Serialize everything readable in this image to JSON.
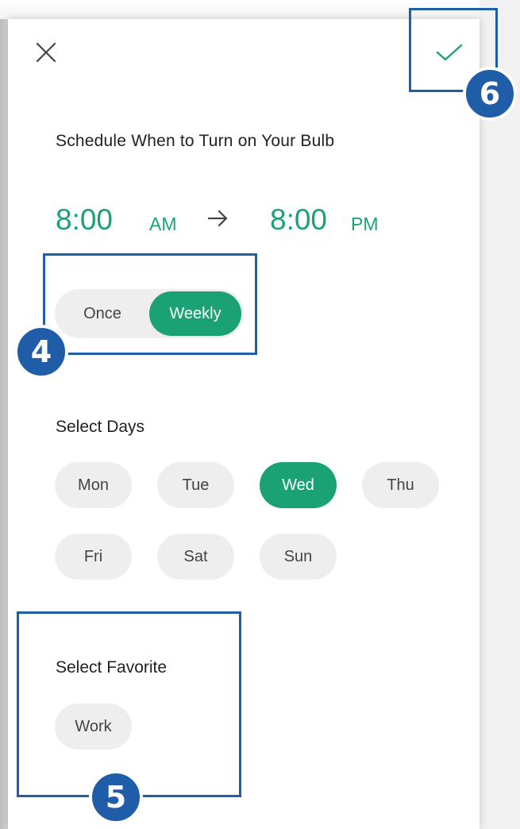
{
  "header": {
    "close_icon": "close-icon",
    "confirm_icon": "check-icon"
  },
  "title": "Schedule When to Turn on Your Bulb",
  "time_range": {
    "start_time": "8:00",
    "start_period": "AM",
    "end_time": "8:00",
    "end_period": "PM",
    "arrow_icon": "arrow-right-icon"
  },
  "frequency": {
    "options": [
      "Once",
      "Weekly"
    ],
    "selected": "Weekly"
  },
  "days": {
    "label": "Select Days",
    "items": [
      "Mon",
      "Tue",
      "Wed",
      "Thu",
      "Fri",
      "Sat",
      "Sun"
    ],
    "selected": [
      "Wed"
    ]
  },
  "favorite": {
    "label": "Select Favorite",
    "items": [
      "Work"
    ]
  },
  "annotations": [
    "4",
    "5",
    "6"
  ],
  "colors": {
    "accent": "#1aa274",
    "chip_bg": "#eeeeee",
    "annotation_blue": "#1f5da8"
  }
}
